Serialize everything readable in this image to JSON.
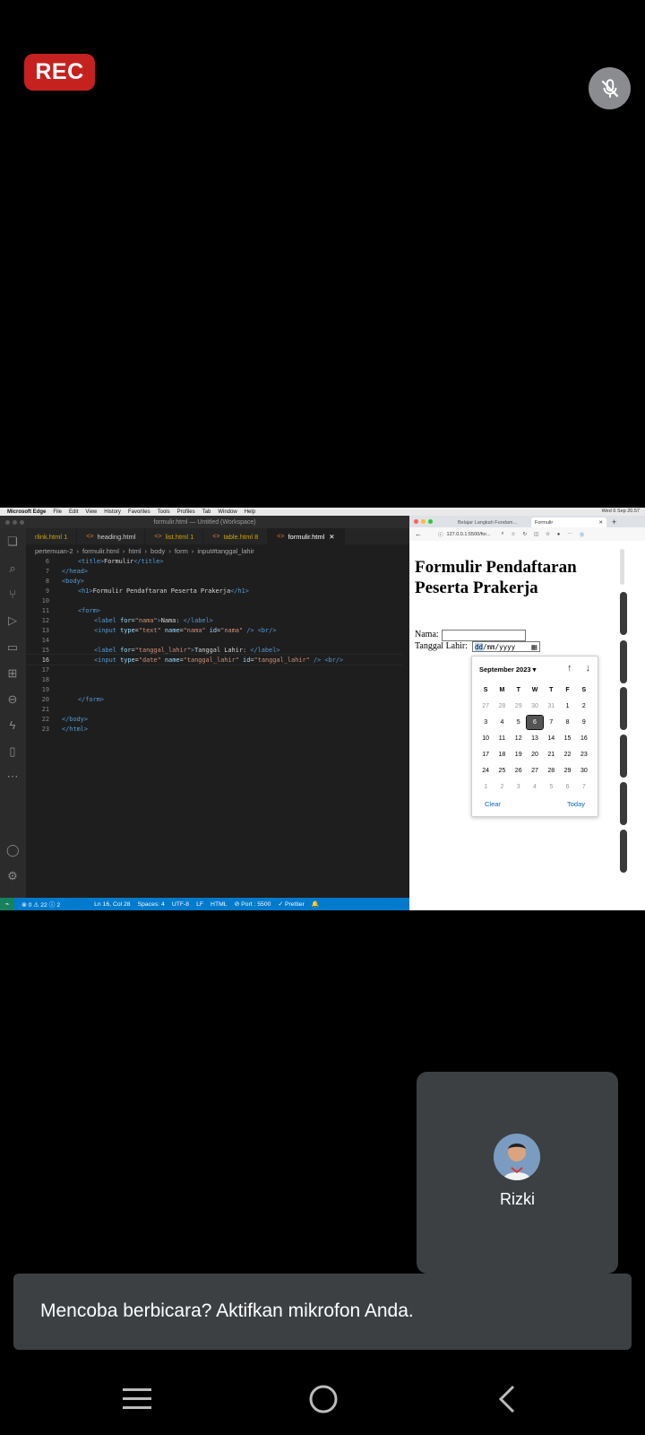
{
  "recording": {
    "label": "REC"
  },
  "mac_menu": {
    "app": "Microsoft Edge",
    "items": [
      "File",
      "Edit",
      "View",
      "History",
      "Favorites",
      "Tools",
      "Profiles",
      "Tab",
      "Window",
      "Help"
    ],
    "clock": "Wed 6 Sep 20.57"
  },
  "vscode": {
    "window_title": "formulir.html — Untitled (Workspace)",
    "tabs": [
      {
        "label": "rlink.html 1"
      },
      {
        "label": "heading.html"
      },
      {
        "label": "list.html 1"
      },
      {
        "label": "table.html 8"
      },
      {
        "label": "formulir.html"
      }
    ],
    "breadcrumb": [
      "pertemuan-2",
      "formulir.html",
      "html",
      "body",
      "form",
      "input#tanggal_lahir"
    ],
    "line_numbers": [
      "6",
      "7",
      "8",
      "9",
      "10",
      "11",
      "12",
      "13",
      "14",
      "15",
      "16",
      "17",
      "18",
      "19",
      "20",
      "21",
      "22",
      "23"
    ],
    "status": {
      "problems": "⊗ 0 ⚠ 22 ⓘ 2",
      "position": "Ln 16, Col 28",
      "spaces": "Spaces: 4",
      "encoding": "UTF-8",
      "eol": "LF",
      "language": "HTML",
      "port": "⊘ Port : 5500",
      "formatter": "✓ Prettier"
    }
  },
  "browser": {
    "tab1": "Belajar Langkah Fundam...",
    "tab2": "Formulir",
    "url": "127.0.0.1:5500/for...",
    "page": {
      "heading": "Formulir Pendaftaran Peserta Prakerja",
      "nama_label": "Nama:",
      "tanggal_label": "Tanggal Lahir:",
      "date_placeholder_dd": "dd",
      "date_placeholder_rest": "/mm/yyyy"
    },
    "calendar": {
      "month": "September 2023 ▾",
      "weekdays": [
        "S",
        "M",
        "T",
        "W",
        "T",
        "F",
        "S"
      ],
      "days": [
        "27",
        "28",
        "29",
        "30",
        "31",
        "1",
        "2",
        "3",
        "4",
        "5",
        "6",
        "7",
        "8",
        "9",
        "10",
        "11",
        "12",
        "13",
        "14",
        "15",
        "16",
        "17",
        "18",
        "19",
        "20",
        "21",
        "22",
        "23",
        "24",
        "25",
        "26",
        "27",
        "28",
        "29",
        "30",
        "1",
        "2",
        "3",
        "4",
        "5",
        "6",
        "7"
      ],
      "selected": "6",
      "clear": "Clear",
      "today": "Today"
    }
  },
  "participant": {
    "name": "Rizki"
  },
  "toast": {
    "text": "Mencoba berbicara? Aktifkan mikrofon Anda."
  }
}
